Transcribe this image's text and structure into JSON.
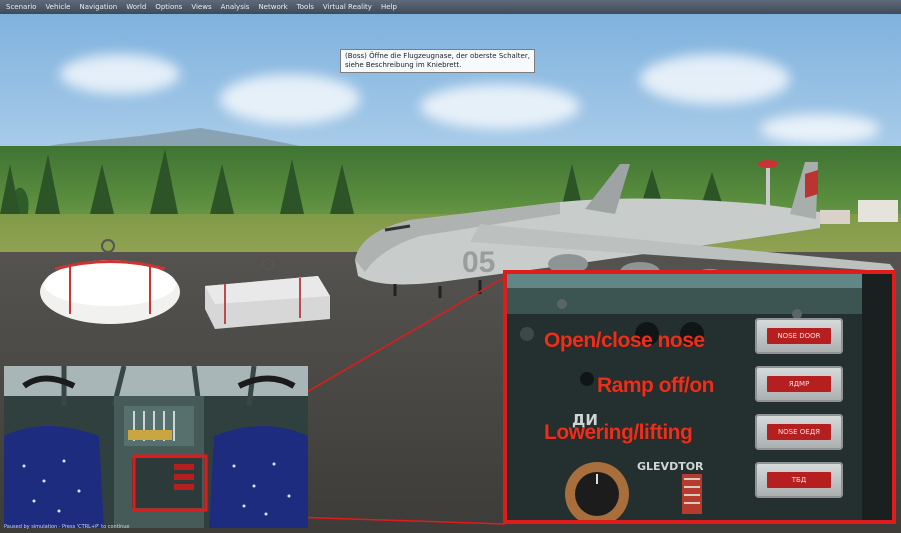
{
  "menu": [
    "Scenario",
    "Vehicle",
    "Navigation",
    "World",
    "Options",
    "Views",
    "Analysis",
    "Network",
    "Tools",
    "Virtual Reality",
    "Help"
  ],
  "briefing": {
    "line1": "(Boss) Öffne die Flugzeugnase, der oberste Schalter,",
    "line2": "siehe Beschreibung im Kniebrett."
  },
  "aircraft": {
    "tail_number": "05"
  },
  "zoom_callout": {
    "labels": [
      "Open/close nose",
      "Ramp off/on",
      "Lowering/lifting"
    ],
    "buttons": [
      "NOSE DOOR",
      "ЯДМР",
      "NOSE OEДЯ",
      "ТБД"
    ],
    "panel_text_di": "ДИ",
    "panel_text_elevator": "GLEVDTOR",
    "border_color": "#e01b1b",
    "label_color": "#e8301c"
  },
  "status_bar": "Paused by simulation · Press 'CTRL+P' to continue"
}
